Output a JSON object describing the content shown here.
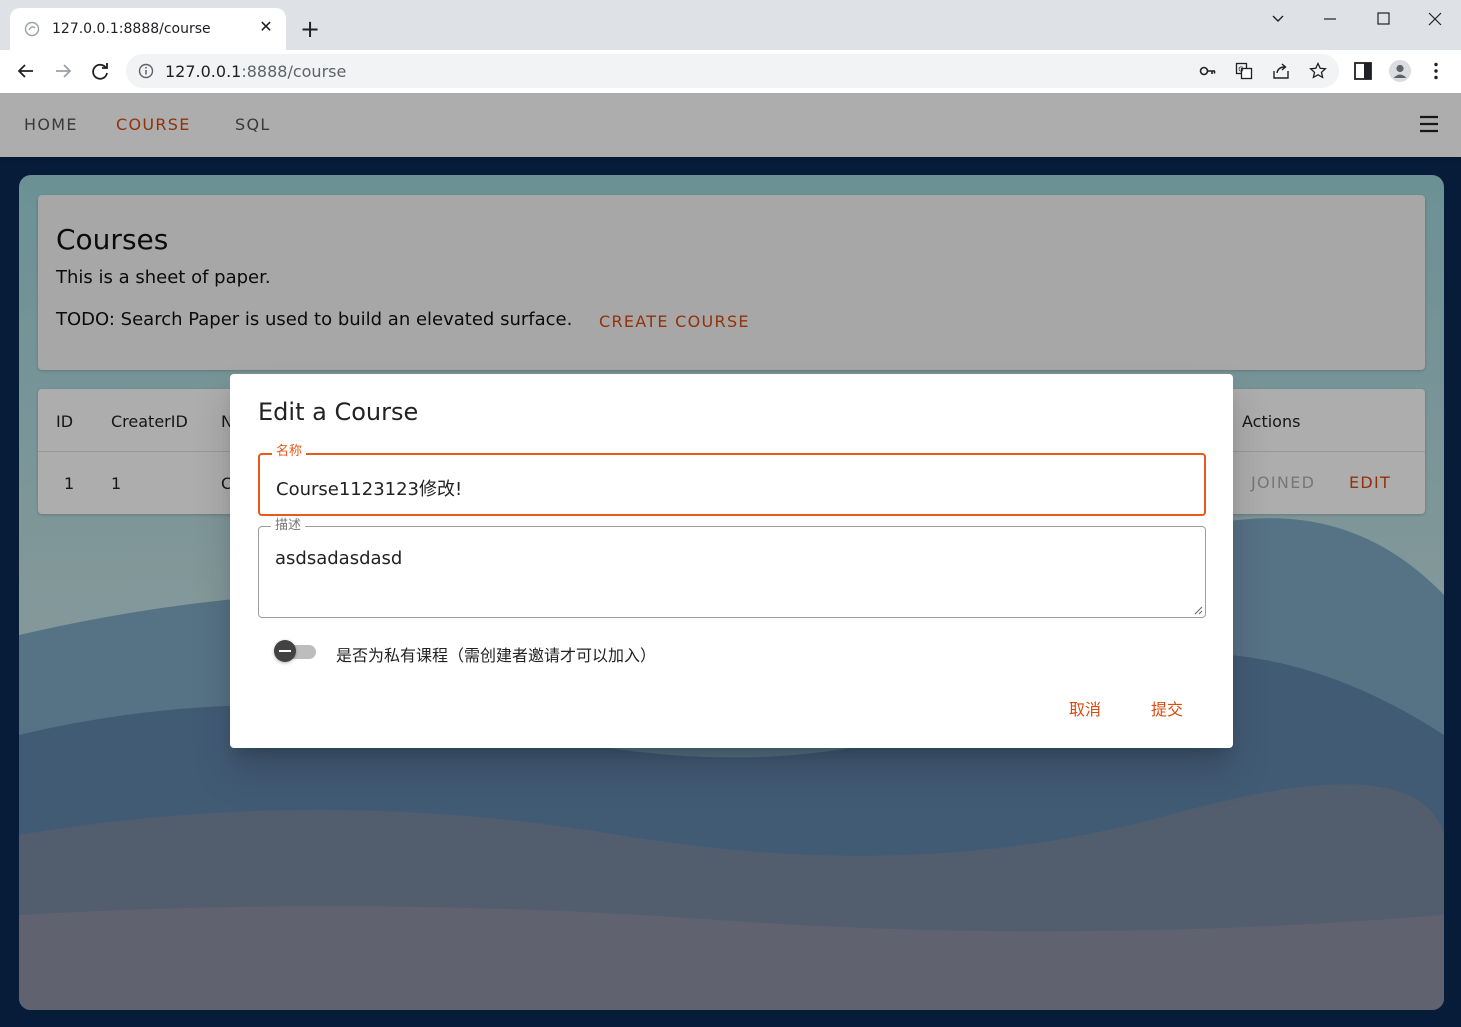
{
  "browser": {
    "tab_title": "127.0.0.1:8888/course",
    "url_host": "127.0.0.1",
    "url_rest": ":8888/course"
  },
  "appbar": {
    "links": [
      "HOME",
      "COURSE",
      "SQL"
    ],
    "active": "COURSE"
  },
  "card": {
    "title": "Courses",
    "subtitle": "This is a sheet of paper.",
    "todo": "TODO: Search Paper is used to build an elevated surface.",
    "create_button": "CREATE COURSE"
  },
  "table": {
    "headers": [
      "ID",
      "CreaterID",
      "N",
      "Actions"
    ],
    "rows": [
      {
        "id": "1",
        "creater_id": "1",
        "name_partial": "C",
        "actions": [
          "JOINED",
          "EDIT"
        ]
      }
    ]
  },
  "dialog": {
    "title": "Edit a Course",
    "name_label": "名称",
    "name_value": "Course1123123修改!",
    "desc_label": "描述",
    "desc_value": "asdsadasdasd",
    "private_label": "是否为私有课程（需创建者邀请才可以加入）",
    "private_on": false,
    "cancel_label": "取消",
    "submit_label": "提交"
  },
  "colors": {
    "accent": "#d64b0e",
    "focus_border": "#e8591a"
  }
}
